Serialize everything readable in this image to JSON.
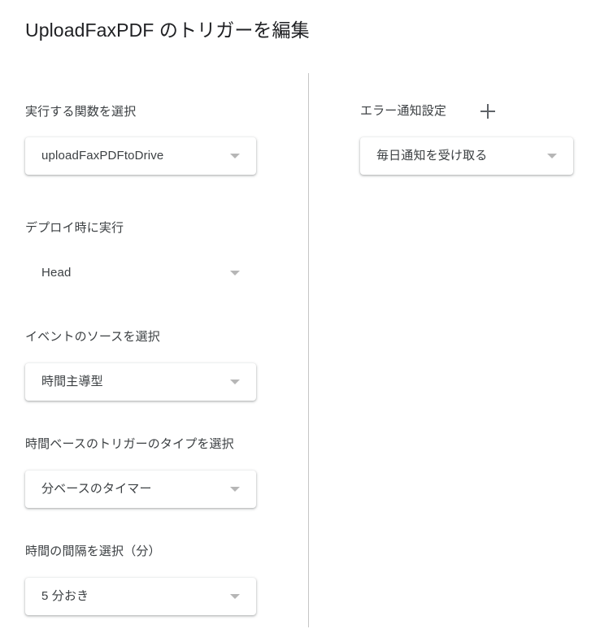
{
  "dialog": {
    "title": "UploadFaxPDF のトリガーを編集"
  },
  "left_column": {
    "fields": [
      {
        "label": "実行する関数を選択",
        "value": "uploadFaxPDFtoDrive",
        "style": "card"
      },
      {
        "label": "デプロイ時に実行",
        "value": "Head",
        "style": "flat"
      },
      {
        "label": "イベントのソースを選択",
        "value": "時間主導型",
        "style": "card"
      },
      {
        "label": "時間ベースのトリガーのタイプを選択",
        "value": "分ベースのタイマー",
        "style": "card"
      },
      {
        "label": "時間の間隔を選択（分）",
        "value": "5 分おき",
        "style": "card"
      }
    ]
  },
  "right_column": {
    "fields": [
      {
        "label": "エラー通知設定",
        "value": "毎日通知を受け取る",
        "style": "card",
        "add_icon": "plus-icon"
      }
    ]
  },
  "icons": {
    "caret": "chevron-down-icon",
    "plus": "plus-icon"
  },
  "colors": {
    "title_text": "#202124",
    "label_text": "#3c4043",
    "value_text": "#3c4043",
    "caret": "#b6b6b6",
    "divider": "#c6c6c6",
    "background": "#ffffff"
  }
}
